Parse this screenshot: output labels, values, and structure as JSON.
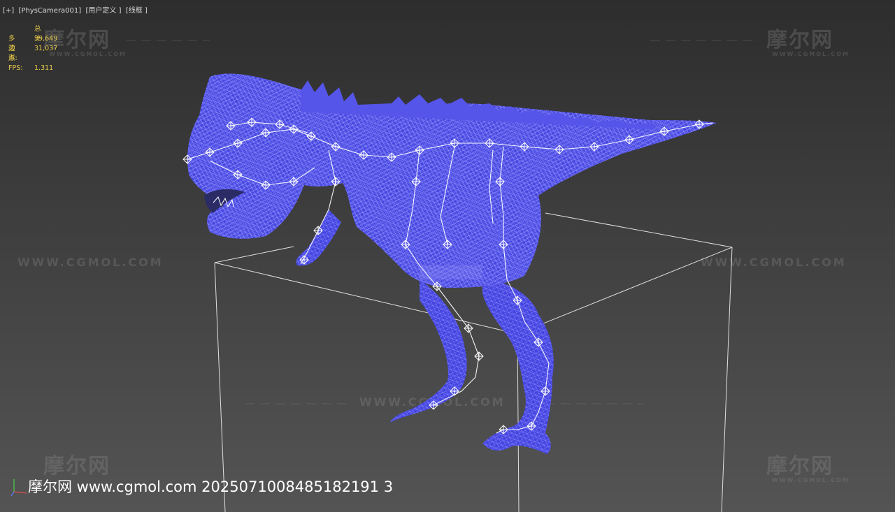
{
  "viewport": {
    "label": "[+]  [PhysCamera001]  [用户定义 ]  [线框 ]"
  },
  "stats": {
    "header": "总计",
    "polys_label": "多边形:",
    "polys_value": "39,649",
    "verts_label": "顶点:",
    "verts_value": "31,037",
    "fps_label": "FPS:",
    "fps_value": "1.311"
  },
  "watermarks": {
    "logo": "摩尔网",
    "sub": "WWW.CGMOL.COM",
    "url": "WWW.CGMOL.COM"
  },
  "footer": {
    "text": "摩尔网 www.cgmol.com 2025071008485182191 3"
  },
  "colors": {
    "wireframe": "#5b5bf0",
    "bones": "#ffffff",
    "stats_text": "#e6c84a",
    "box_lines": "#e0e0e0"
  },
  "icons": {
    "axis": "axis-tripod-icon"
  }
}
